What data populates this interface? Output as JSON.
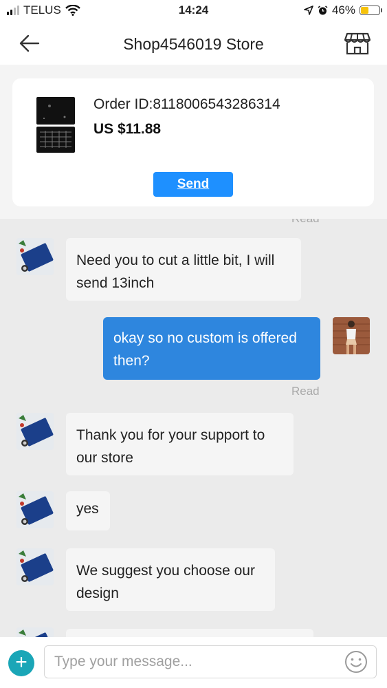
{
  "status": {
    "carrier": "TELUS",
    "time": "14:24",
    "battery": "46%",
    "battery_level": 0.46
  },
  "header": {
    "title": "Shop4546019 Store",
    "back_icon": "arrow-left-icon",
    "store_icon": "storefront-icon"
  },
  "order": {
    "id_text": "Order ID:8118006543286314",
    "price": "US $11.88",
    "send_label": "Send"
  },
  "chat": {
    "top_read_partial": "Read",
    "messages": [
      {
        "from": "store",
        "text": "Need you to cut a little bit, I will send 13inch"
      },
      {
        "from": "me",
        "text": "okay so no custom is offered then?",
        "status": "Read"
      },
      {
        "from": "store",
        "text": "Thank you for your support to our store"
      },
      {
        "from": "store",
        "text": "yes"
      },
      {
        "from": "store",
        "text": "We suggest you choose our design"
      }
    ]
  },
  "composer": {
    "placeholder": "Type your message...",
    "plus_icon": "plus-icon",
    "emoji_icon": "smiley-icon"
  },
  "colors": {
    "accent": "#1e90ff",
    "outgoing_bubble": "#2e86de",
    "plus_button": "#1aa6b7"
  }
}
